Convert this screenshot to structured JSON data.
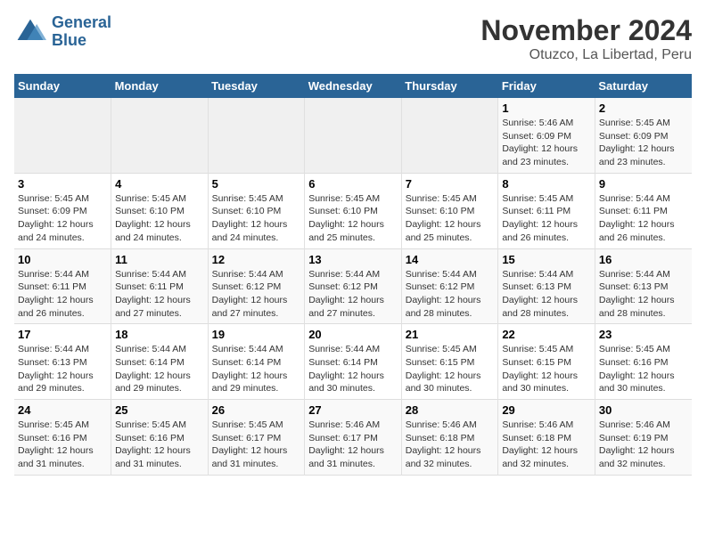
{
  "logo": {
    "line1": "General",
    "line2": "Blue"
  },
  "title": "November 2024",
  "subtitle": "Otuzco, La Libertad, Peru",
  "weekdays": [
    "Sunday",
    "Monday",
    "Tuesday",
    "Wednesday",
    "Thursday",
    "Friday",
    "Saturday"
  ],
  "weeks": [
    [
      {
        "day": "",
        "info": ""
      },
      {
        "day": "",
        "info": ""
      },
      {
        "day": "",
        "info": ""
      },
      {
        "day": "",
        "info": ""
      },
      {
        "day": "",
        "info": ""
      },
      {
        "day": "1",
        "info": "Sunrise: 5:46 AM\nSunset: 6:09 PM\nDaylight: 12 hours and 23 minutes."
      },
      {
        "day": "2",
        "info": "Sunrise: 5:45 AM\nSunset: 6:09 PM\nDaylight: 12 hours and 23 minutes."
      }
    ],
    [
      {
        "day": "3",
        "info": "Sunrise: 5:45 AM\nSunset: 6:09 PM\nDaylight: 12 hours and 24 minutes."
      },
      {
        "day": "4",
        "info": "Sunrise: 5:45 AM\nSunset: 6:10 PM\nDaylight: 12 hours and 24 minutes."
      },
      {
        "day": "5",
        "info": "Sunrise: 5:45 AM\nSunset: 6:10 PM\nDaylight: 12 hours and 24 minutes."
      },
      {
        "day": "6",
        "info": "Sunrise: 5:45 AM\nSunset: 6:10 PM\nDaylight: 12 hours and 25 minutes."
      },
      {
        "day": "7",
        "info": "Sunrise: 5:45 AM\nSunset: 6:10 PM\nDaylight: 12 hours and 25 minutes."
      },
      {
        "day": "8",
        "info": "Sunrise: 5:45 AM\nSunset: 6:11 PM\nDaylight: 12 hours and 26 minutes."
      },
      {
        "day": "9",
        "info": "Sunrise: 5:44 AM\nSunset: 6:11 PM\nDaylight: 12 hours and 26 minutes."
      }
    ],
    [
      {
        "day": "10",
        "info": "Sunrise: 5:44 AM\nSunset: 6:11 PM\nDaylight: 12 hours and 26 minutes."
      },
      {
        "day": "11",
        "info": "Sunrise: 5:44 AM\nSunset: 6:11 PM\nDaylight: 12 hours and 27 minutes."
      },
      {
        "day": "12",
        "info": "Sunrise: 5:44 AM\nSunset: 6:12 PM\nDaylight: 12 hours and 27 minutes."
      },
      {
        "day": "13",
        "info": "Sunrise: 5:44 AM\nSunset: 6:12 PM\nDaylight: 12 hours and 27 minutes."
      },
      {
        "day": "14",
        "info": "Sunrise: 5:44 AM\nSunset: 6:12 PM\nDaylight: 12 hours and 28 minutes."
      },
      {
        "day": "15",
        "info": "Sunrise: 5:44 AM\nSunset: 6:13 PM\nDaylight: 12 hours and 28 minutes."
      },
      {
        "day": "16",
        "info": "Sunrise: 5:44 AM\nSunset: 6:13 PM\nDaylight: 12 hours and 28 minutes."
      }
    ],
    [
      {
        "day": "17",
        "info": "Sunrise: 5:44 AM\nSunset: 6:13 PM\nDaylight: 12 hours and 29 minutes."
      },
      {
        "day": "18",
        "info": "Sunrise: 5:44 AM\nSunset: 6:14 PM\nDaylight: 12 hours and 29 minutes."
      },
      {
        "day": "19",
        "info": "Sunrise: 5:44 AM\nSunset: 6:14 PM\nDaylight: 12 hours and 29 minutes."
      },
      {
        "day": "20",
        "info": "Sunrise: 5:44 AM\nSunset: 6:14 PM\nDaylight: 12 hours and 30 minutes."
      },
      {
        "day": "21",
        "info": "Sunrise: 5:45 AM\nSunset: 6:15 PM\nDaylight: 12 hours and 30 minutes."
      },
      {
        "day": "22",
        "info": "Sunrise: 5:45 AM\nSunset: 6:15 PM\nDaylight: 12 hours and 30 minutes."
      },
      {
        "day": "23",
        "info": "Sunrise: 5:45 AM\nSunset: 6:16 PM\nDaylight: 12 hours and 30 minutes."
      }
    ],
    [
      {
        "day": "24",
        "info": "Sunrise: 5:45 AM\nSunset: 6:16 PM\nDaylight: 12 hours and 31 minutes."
      },
      {
        "day": "25",
        "info": "Sunrise: 5:45 AM\nSunset: 6:16 PM\nDaylight: 12 hours and 31 minutes."
      },
      {
        "day": "26",
        "info": "Sunrise: 5:45 AM\nSunset: 6:17 PM\nDaylight: 12 hours and 31 minutes."
      },
      {
        "day": "27",
        "info": "Sunrise: 5:46 AM\nSunset: 6:17 PM\nDaylight: 12 hours and 31 minutes."
      },
      {
        "day": "28",
        "info": "Sunrise: 5:46 AM\nSunset: 6:18 PM\nDaylight: 12 hours and 32 minutes."
      },
      {
        "day": "29",
        "info": "Sunrise: 5:46 AM\nSunset: 6:18 PM\nDaylight: 12 hours and 32 minutes."
      },
      {
        "day": "30",
        "info": "Sunrise: 5:46 AM\nSunset: 6:19 PM\nDaylight: 12 hours and 32 minutes."
      }
    ]
  ]
}
